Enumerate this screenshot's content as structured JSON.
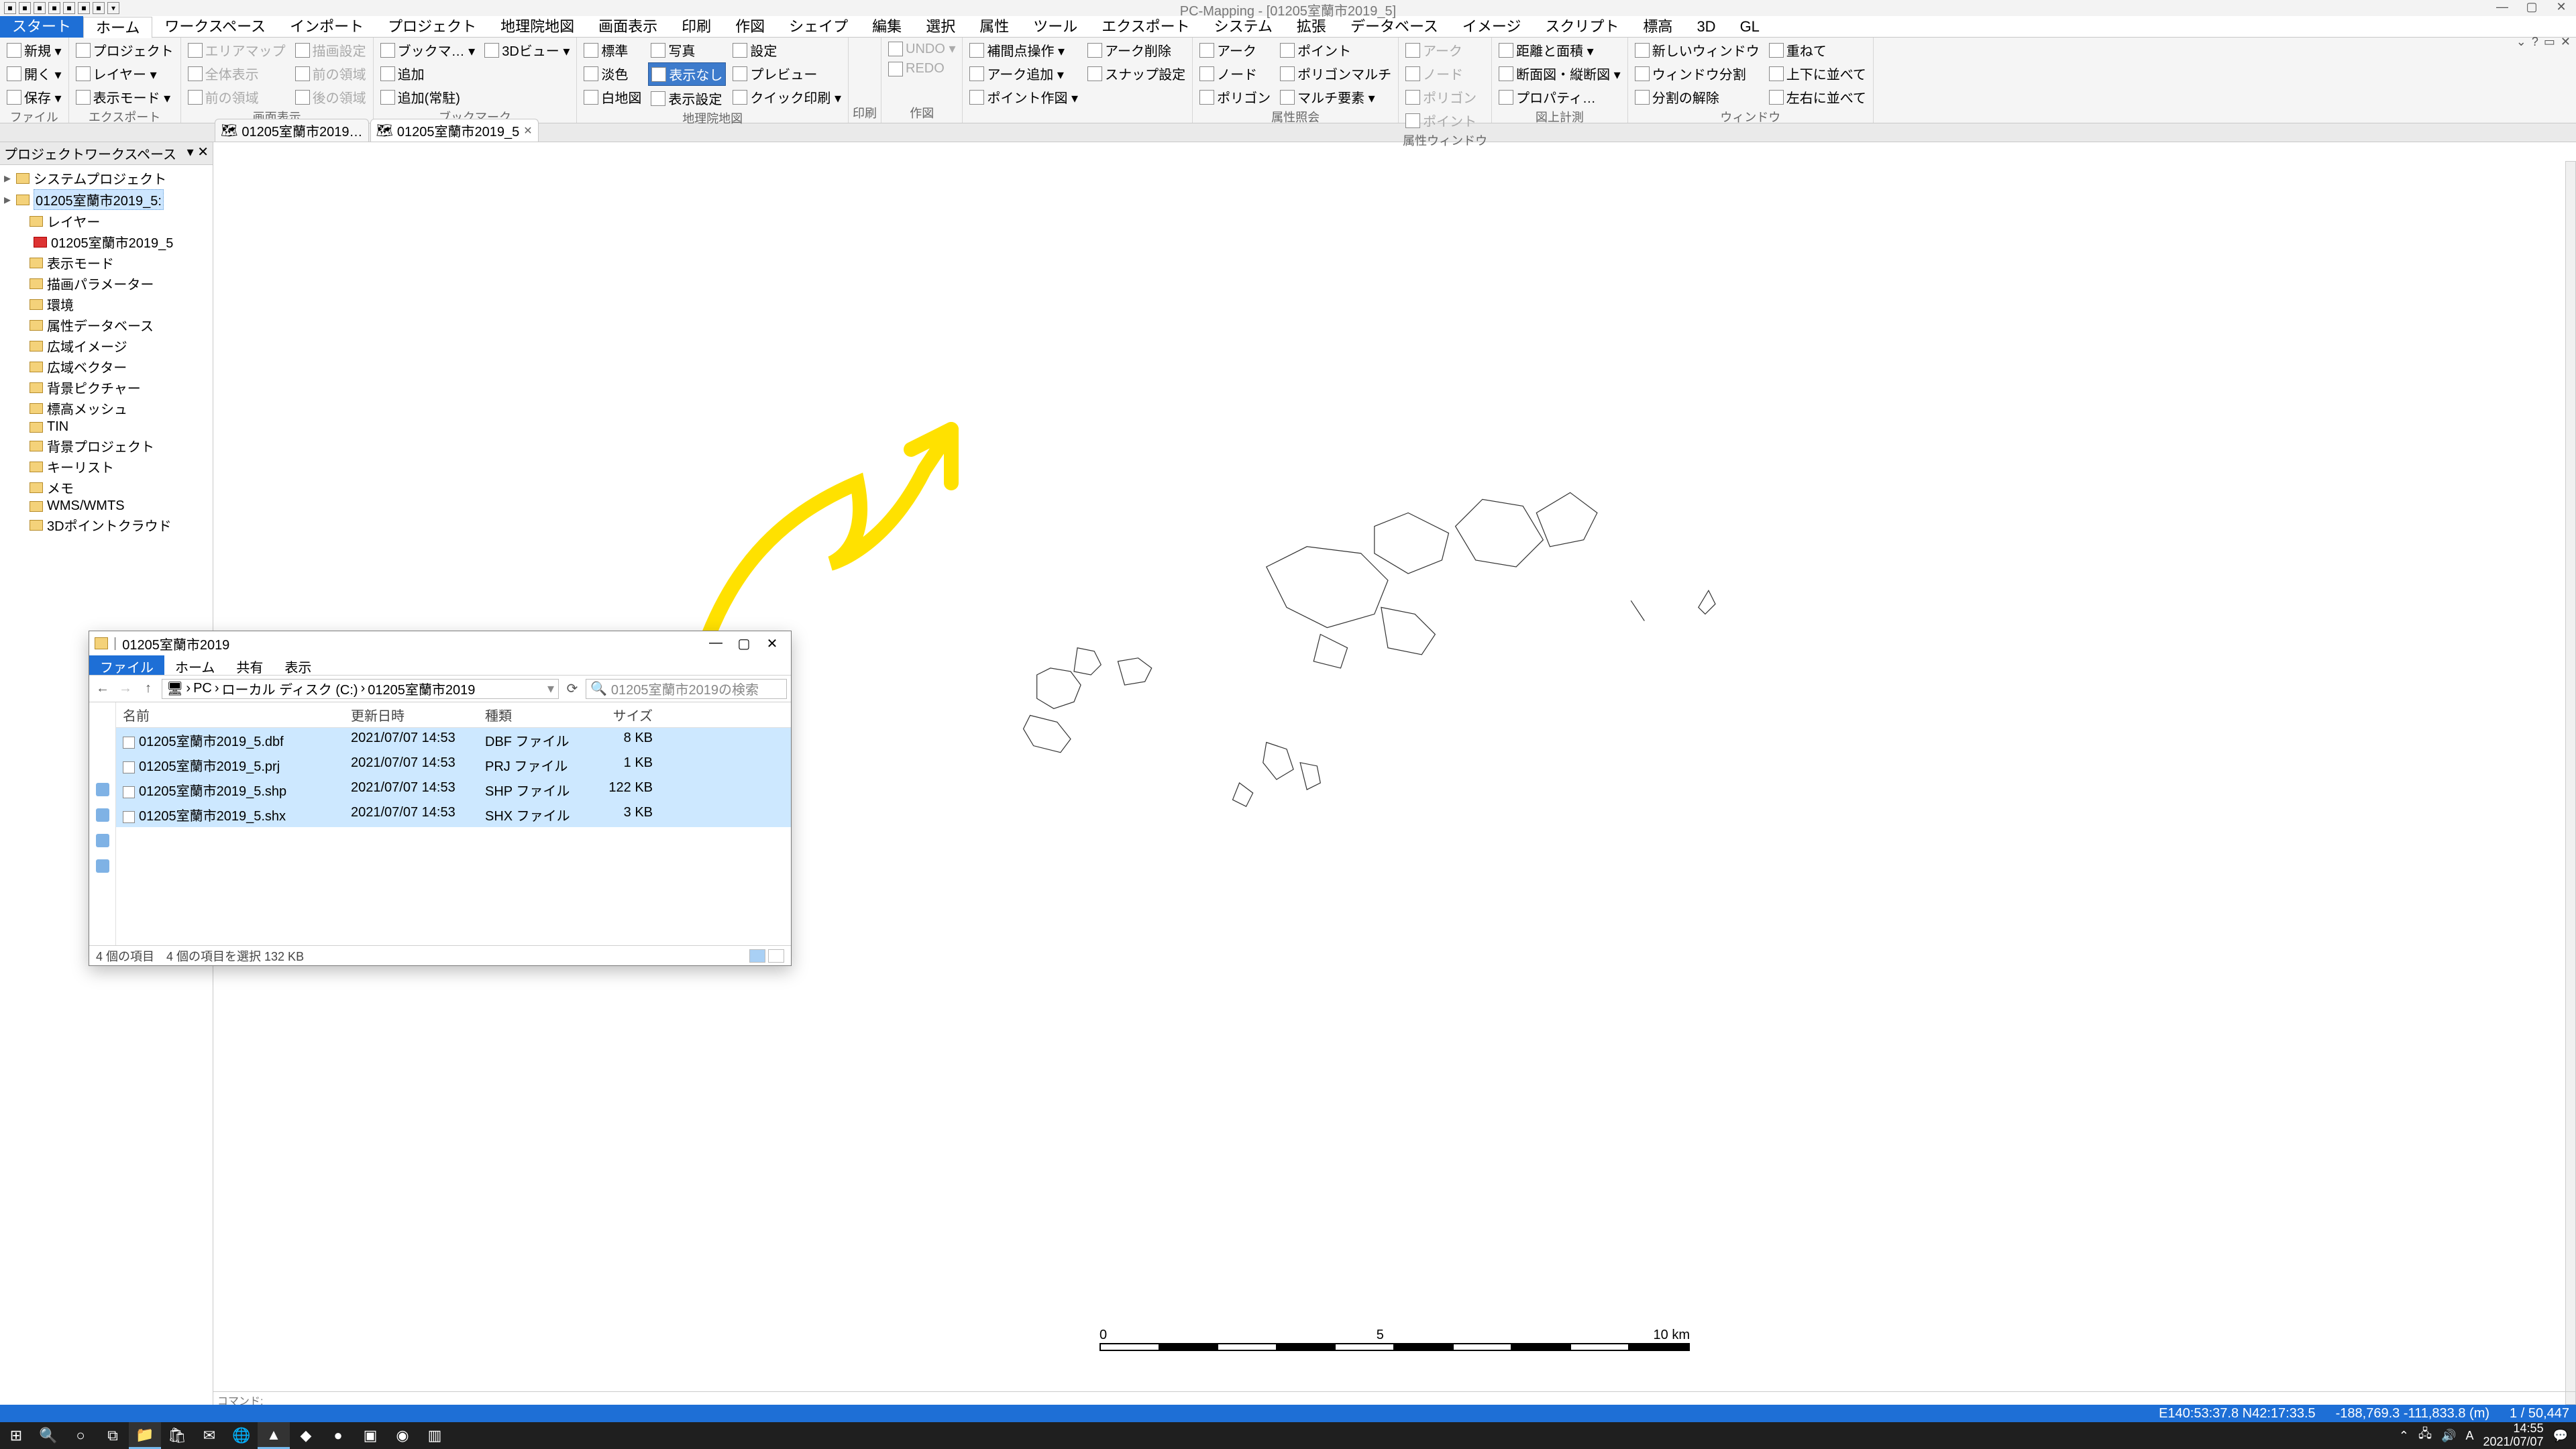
{
  "app": {
    "title": "PC-Mapping - [01205室蘭市2019_5]"
  },
  "qat_icons": [
    "save",
    "open",
    "new",
    "undo",
    "redo",
    "print",
    "db",
    "run",
    "cfg"
  ],
  "menus": [
    "スタート",
    "ホーム",
    "ワークスペース",
    "インポート",
    "プロジェクト",
    "地理院地図",
    "画面表示",
    "印刷",
    "作図",
    "シェイプ",
    "編集",
    "選択",
    "属性",
    "ツール",
    "エクスポート",
    "システム",
    "拡張",
    "データベース",
    "イメージ",
    "スクリプト",
    "標高",
    "3D",
    "GL"
  ],
  "menu_start_idx": 0,
  "menu_active_idx": 1,
  "ribbon": {
    "groups": [
      {
        "label": "ファイル",
        "cols": [
          [
            "新規 ▾",
            "開く ▾",
            "保存 ▾"
          ]
        ]
      },
      {
        "label": "エクスポート",
        "cols": [
          [
            "プロジェクト",
            "レイヤー ▾",
            "表示モード ▾"
          ]
        ]
      },
      {
        "label": "画面表示",
        "cols": [
          [
            "エリアマップ",
            "全体表示",
            "前の領域"
          ],
          [
            "描画設定",
            "前の領域",
            "後の領域"
          ]
        ],
        "disabled": true
      },
      {
        "label": "ブックマーク",
        "cols": [
          [
            "ブックマ… ▾",
            "追加",
            "追加(常駐)"
          ],
          [
            "3Dビュー ▾"
          ]
        ]
      },
      {
        "label": "地理院地図",
        "cols": [
          [
            "標準",
            "淡色",
            "白地図"
          ],
          [
            "写真",
            "表示なし",
            "表示設定"
          ],
          [
            "設定",
            "プレビュー",
            "クイック印刷 ▾"
          ]
        ],
        "blue_idx": "1.1"
      },
      {
        "label": "印刷",
        "cols": [
          []
        ]
      },
      {
        "label": "作図",
        "cols": [
          [
            "UNDO ▾",
            "REDO"
          ]
        ],
        "disabled": true
      },
      {
        "label": "",
        "cols": [
          [
            "補間点操作 ▾",
            "アーク追加 ▾",
            "ポイント作図 ▾"
          ],
          [
            "アーク削除",
            "スナップ設定"
          ]
        ]
      },
      {
        "label": "属性照会",
        "cols": [
          [
            "アーク",
            "ノード",
            "ポリゴン"
          ],
          [
            "ポイント",
            "ポリゴンマルチ",
            "マルチ要素 ▾"
          ]
        ]
      },
      {
        "label": "属性ウィンドウ",
        "cols": [
          [
            "アーク",
            "ノード",
            "ポリゴン",
            "ポイント"
          ]
        ],
        "disabled": true
      },
      {
        "label": "図上計測",
        "cols": [
          [
            "距離と面積 ▾",
            "断面図・縦断図 ▾",
            "プロパティ…"
          ]
        ]
      },
      {
        "label": "ウィンドウ",
        "cols": [
          [
            "新しいウィンドウ",
            "ウィンドウ分割",
            "分割の解除"
          ],
          [
            "重ねて",
            "上下に並べて",
            "左右に並べて"
          ]
        ]
      }
    ]
  },
  "doc_tabs": [
    {
      "label": "01205室蘭市2019…",
      "active": false
    },
    {
      "label": "01205室蘭市2019_5",
      "active": true
    }
  ],
  "workspace": {
    "title": "プロジェクトワークスペース",
    "nodes": [
      {
        "lvl": 0,
        "label": "システムプロジェクト"
      },
      {
        "lvl": 0,
        "label": "01205室蘭市2019_5:",
        "sel": true
      },
      {
        "lvl": 1,
        "label": "レイヤー"
      },
      {
        "lvl": 2,
        "label": "01205室蘭市2019_5",
        "red": true
      },
      {
        "lvl": 1,
        "label": "表示モード"
      },
      {
        "lvl": 1,
        "label": "描画パラメーター"
      },
      {
        "lvl": 1,
        "label": "環境"
      },
      {
        "lvl": 1,
        "label": "属性データベース"
      },
      {
        "lvl": 1,
        "label": "広域イメージ"
      },
      {
        "lvl": 1,
        "label": "広域ベクター"
      },
      {
        "lvl": 1,
        "label": "背景ピクチャー"
      },
      {
        "lvl": 1,
        "label": "標高メッシュ"
      },
      {
        "lvl": 1,
        "label": "TIN"
      },
      {
        "lvl": 1,
        "label": "背景プロジェクト"
      },
      {
        "lvl": 1,
        "label": "キーリスト"
      },
      {
        "lvl": 1,
        "label": "メモ"
      },
      {
        "lvl": 1,
        "label": "WMS/WMTS"
      },
      {
        "lvl": 1,
        "label": "3Dポイントクラウド"
      }
    ]
  },
  "scale": {
    "left": "0",
    "mid": "5",
    "right": "10 km"
  },
  "status": {
    "lonlat": "E140:53:37.8 N42:17:33.5",
    "xy": "-188,769.3 -111,833.8 (m)",
    "scale": "1 / 50,447"
  },
  "cmd": "コマンド:",
  "explorer": {
    "title": "01205室蘭市2019",
    "tabs": [
      "ファイル",
      "ホーム",
      "共有",
      "表示"
    ],
    "tab_active_idx": 0,
    "crumbs": [
      "PC",
      "ローカル ディスク (C:)",
      "01205室蘭市2019"
    ],
    "search_placeholder": "01205室蘭市2019の検索",
    "columns": {
      "name": "名前",
      "mod": "更新日時",
      "type": "種類",
      "size": "サイズ"
    },
    "rows": [
      {
        "name": "01205室蘭市2019_5.dbf",
        "mod": "2021/07/07 14:53",
        "type": "DBF ファイル",
        "size": "8 KB"
      },
      {
        "name": "01205室蘭市2019_5.prj",
        "mod": "2021/07/07 14:53",
        "type": "PRJ ファイル",
        "size": "1 KB"
      },
      {
        "name": "01205室蘭市2019_5.shp",
        "mod": "2021/07/07 14:53",
        "type": "SHP ファイル",
        "size": "122 KB"
      },
      {
        "name": "01205室蘭市2019_5.shx",
        "mod": "2021/07/07 14:53",
        "type": "SHX ファイル",
        "size": "3 KB"
      }
    ],
    "status_left": "4 個の項目",
    "status_sel": "4 個の項目を選択 132 KB"
  },
  "tray": {
    "ime": "A",
    "time": "14:55",
    "date": "2021/07/07"
  },
  "help_icons": [
    "▭",
    "?",
    "—",
    "✕"
  ]
}
